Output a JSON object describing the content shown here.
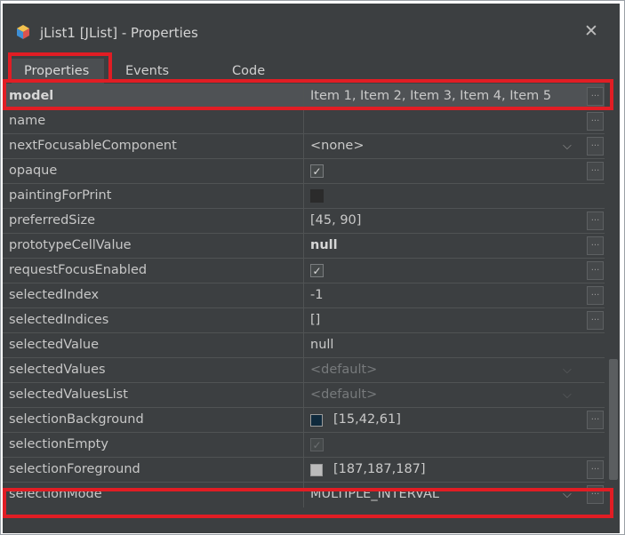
{
  "window": {
    "title": "jList1 [JList] - Properties",
    "icon": "java-bean-cube-icon",
    "close_glyph": "✕"
  },
  "tabs": [
    {
      "label": "Properties"
    },
    {
      "label": "Events"
    },
    {
      "label": "Code"
    }
  ],
  "properties": [
    {
      "name": "model",
      "value": "Item 1, Item 2, Item 3, Item 4, Item 5"
    },
    {
      "name": "name",
      "value": ""
    },
    {
      "name": "nextFocusableComponent",
      "value": "<none>"
    },
    {
      "name": "opaque",
      "checked": true
    },
    {
      "name": "paintingForPrint",
      "checked": false
    },
    {
      "name": "preferredSize",
      "value": "[45, 90]"
    },
    {
      "name": "prototypeCellValue",
      "value": "null"
    },
    {
      "name": "requestFocusEnabled",
      "checked": true
    },
    {
      "name": "selectedIndex",
      "value": "-1"
    },
    {
      "name": "selectedIndices",
      "value": "[]"
    },
    {
      "name": "selectedValue",
      "value": "null"
    },
    {
      "name": "selectedValues",
      "value": "<default>"
    },
    {
      "name": "selectedValuesList",
      "value": "<default>"
    },
    {
      "name": "selectionBackground",
      "value": "[15,42,61]",
      "color": "#0f2a3d"
    },
    {
      "name": "selectionEmpty",
      "checked": true
    },
    {
      "name": "selectionForeground",
      "value": "[187,187,187]",
      "color": "#bbbbbb"
    },
    {
      "name": "selectionMode",
      "value": "MULTIPLE_INTERVAL"
    }
  ],
  "glyphs": {
    "ellipsis": "...",
    "check": "✓",
    "chevron": "⌵"
  },
  "colors": {
    "panel_bg": "#3c3f41",
    "highlight": "#e11d24"
  }
}
